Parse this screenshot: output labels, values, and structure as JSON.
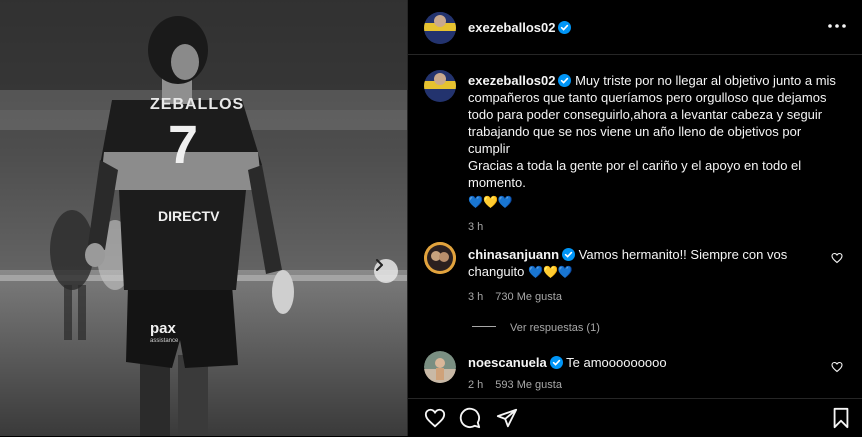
{
  "post": {
    "username": "exezeballos02",
    "more_icon": "ellipsis-icon",
    "caption_line1": "Muy triste por no llegar al objetivo junto a mis",
    "caption_line2": "compañeros que tanto queríamos pero orgulloso que dejamos",
    "caption_line3": "todo para poder conseguirlo,ahora a levantar cabeza y seguir",
    "caption_line4": "trabajando que se nos viene un año lleno de objetivos por",
    "caption_line5": "cumplir",
    "caption_line6": "Gracias a toda la gente por el cariño y el apoyo en todo el",
    "caption_line7": "momento.",
    "caption_emojis": "💙💛💙",
    "time": "3 h"
  },
  "photo": {
    "jersey_name": "ZEBALLOS",
    "jersey_number": "7",
    "sponsor": "DIRECTV",
    "shorts_logo": "pax",
    "shorts_logo_sub": "assistance",
    "next_icon": "chevron-right-icon"
  },
  "comments": [
    {
      "username": "chinasanjuann",
      "text_line1": "Vamos hermanito!! Siempre con vos",
      "text_line2": "changuito",
      "emojis": "💙💛💙",
      "time": "3 h",
      "likes": "730 Me gusta",
      "replies": "Ver respuestas (1)"
    },
    {
      "username": "noescanuela",
      "text_line1": "Te amooooooooo",
      "time": "2 h",
      "likes": "593 Me gusta"
    }
  ],
  "colors": {
    "verified": "#0095f6",
    "background": "#000000",
    "text": "#f5f5f5",
    "muted": "#a8a8a8"
  },
  "actions": [
    "heart-icon",
    "comment-icon",
    "share-icon",
    "save-icon"
  ]
}
